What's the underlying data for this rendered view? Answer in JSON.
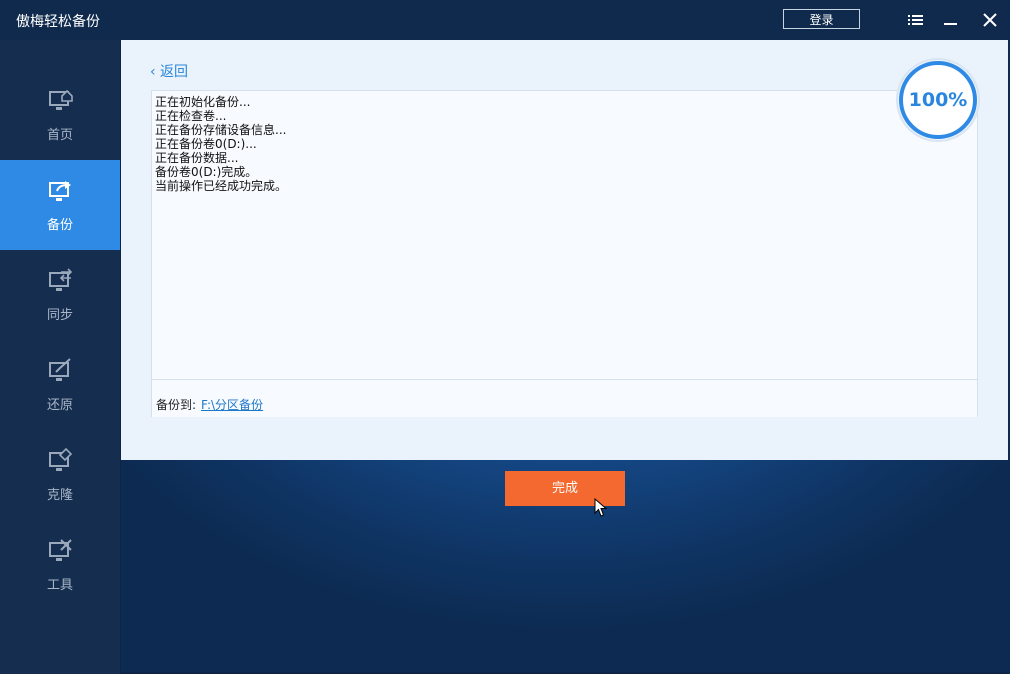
{
  "window": {
    "title": "傲梅轻松备份",
    "login_label": "登录",
    "icons": [
      "menu-icon",
      "minimize-icon",
      "close-icon"
    ]
  },
  "sidebar": {
    "items": [
      {
        "label": "首页",
        "icon": "home-monitor-icon",
        "active": false
      },
      {
        "label": "备份",
        "icon": "backup-export-icon",
        "active": true
      },
      {
        "label": "同步",
        "icon": "sync-icon",
        "active": false
      },
      {
        "label": "还原",
        "icon": "restore-icon",
        "active": false
      },
      {
        "label": "克隆",
        "icon": "clone-icon",
        "active": false
      },
      {
        "label": "工具",
        "icon": "tools-icon",
        "active": false
      }
    ]
  },
  "main": {
    "back_label": "‹ 返回",
    "progress_percent": 100,
    "progress_text": "100%",
    "log": [
      "正在初始化备份...",
      "正在检查卷...",
      "正在备份存储设备信息...",
      "正在备份卷0(D:)...",
      "正在备份数据...",
      "备份卷0(D:)完成。",
      "当前操作已经成功完成。"
    ],
    "destination_label": "备份到:",
    "destination_path": "F:\\分区备份",
    "finish_label": "完成"
  },
  "colors": {
    "accent": "#2f8ae6",
    "finish_button": "#f4692f",
    "titlebar": "#0f2a4d",
    "sidebar": "#152d4f"
  }
}
